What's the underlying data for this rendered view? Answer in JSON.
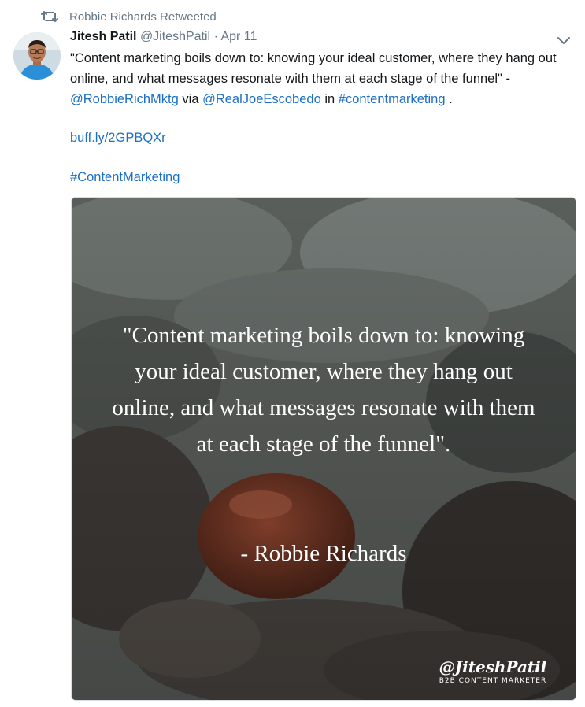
{
  "retweet": {
    "label": "Robbie Richards Retweeted",
    "icon": "retweet-icon"
  },
  "author": {
    "name": "Jitesh Patil",
    "handle": "@JiteshPatil",
    "separator": "·",
    "date": "Apr 11"
  },
  "tweet": {
    "text_part1": "\"Content marketing boils down to: knowing your ideal customer, where they hang out online, and what messages resonate with them at each stage of the funnel\" - ",
    "mention1": "@RobbieRichMktg",
    "text_part2": " via ",
    "mention2": "@RealJoeEscobedo",
    "text_part3": " in ",
    "hashtag_inline": "#contentmarketing",
    "text_part4": " .",
    "short_link": "buff.ly/2GPBQXr",
    "hashtag_line": "#ContentMarketing"
  },
  "media": {
    "quote": "\"Content marketing boils down to: knowing your ideal customer, where they hang out online, and what messages resonate with them at each stage of the funnel\".",
    "quote_author": "- Robbie Richards",
    "watermark_signature": "@JiteshPatil",
    "watermark_subtitle": "B2B CONTENT MARKETER"
  },
  "colors": {
    "link": "#1b6fc4",
    "muted": "#657786",
    "text": "#14171a"
  },
  "icons": {
    "menu": "chevron-down-icon"
  }
}
